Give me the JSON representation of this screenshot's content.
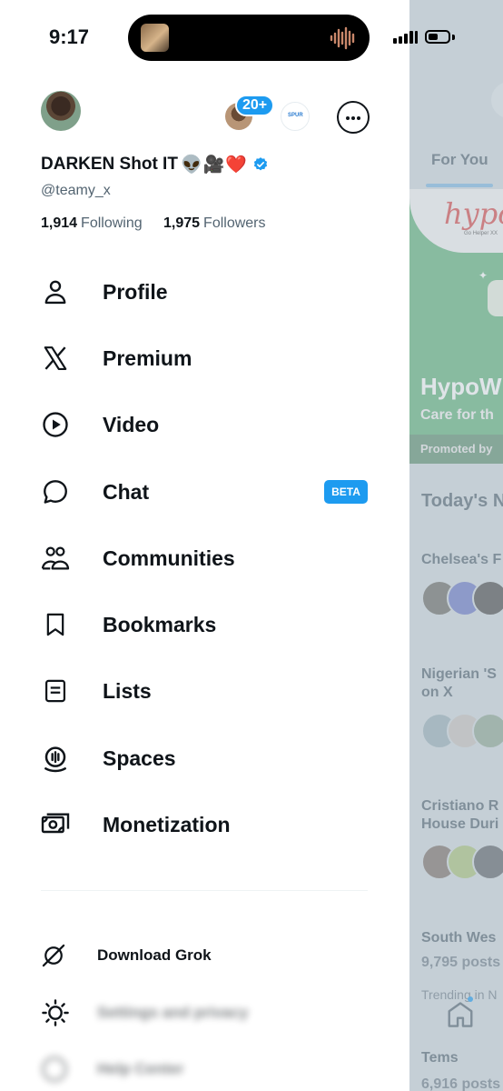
{
  "status_bar": {
    "time": "9:17"
  },
  "account": {
    "name": "DARKEN Shot IT",
    "emojis": "👽🎥❤️",
    "handle": "@teamy_x",
    "following_count": "1,914",
    "following_label": "Following",
    "followers_count": "1,975",
    "followers_label": "Followers",
    "badge_count": "20+",
    "other_account_text": "SPUR"
  },
  "menu": {
    "items": [
      {
        "label": "Profile",
        "icon": "person-icon"
      },
      {
        "label": "Premium",
        "icon": "x-logo-icon"
      },
      {
        "label": "Video",
        "icon": "play-circle-icon"
      },
      {
        "label": "Chat",
        "icon": "chat-bubble-icon",
        "badge": "BETA"
      },
      {
        "label": "Communities",
        "icon": "communities-icon"
      },
      {
        "label": "Bookmarks",
        "icon": "bookmark-icon"
      },
      {
        "label": "Lists",
        "icon": "list-icon"
      },
      {
        "label": "Spaces",
        "icon": "spaces-icon"
      },
      {
        "label": "Monetization",
        "icon": "money-icon"
      }
    ],
    "download_grok": "Download Grok",
    "settings": "Settings and privacy",
    "help": "Help Center"
  },
  "feed": {
    "tab": "For You",
    "ad_logo": "hypo",
    "ad_small": "Go Helper XX",
    "ad_title": "HypoW",
    "ad_subtitle": "Care for th",
    "ad_promoted": "Promoted by",
    "section_title": "Today's N",
    "trend_1": "Chelsea's F",
    "trend_2": "Nigerian 'S\non X",
    "trend_3": "Cristiano R\nHouse Duri",
    "trend_4": "South Wes",
    "trend_4_posts": "9,795 posts",
    "trend_meta": "Trending in N",
    "trend_5": "Tems",
    "trend_5_posts": "6,916 posts"
  },
  "colors": {
    "accent": "#1d9bf0",
    "text": "#0f1419",
    "secondary": "#536471"
  }
}
